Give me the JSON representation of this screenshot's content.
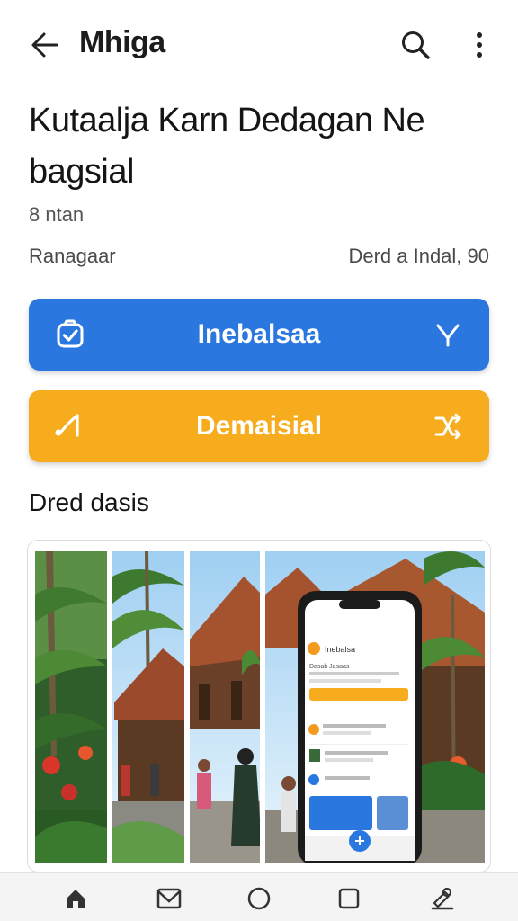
{
  "appbar": {
    "title": "Mhiga",
    "back_icon": "arrow-left-icon",
    "search_icon": "search-icon",
    "more_icon": "more-vertical-icon"
  },
  "page": {
    "heading": "Kutaalja Karn Dedagan Ne bagsial",
    "subtitle": "8 ntan",
    "meta_left": "Ranagaar",
    "meta_right": "Derd a Indal, 90"
  },
  "actions": {
    "primary": {
      "label": "Inebalsaa",
      "left_icon": "shield-check-icon",
      "right_icon": "chevron-down-icon",
      "color": "#2b77e0"
    },
    "secondary": {
      "label": "Demaisial",
      "left_icon": "route-icon",
      "right_icon": "shuffle-icon",
      "color": "#f6ac1d"
    }
  },
  "section": {
    "title": "Dred dasis"
  },
  "gallery": {
    "phone_mockup": {
      "header_title": "Inebalsa",
      "header_subtitle": "Dasab Jasaas"
    }
  },
  "bottom_nav": {
    "items": [
      "home-icon",
      "mail-icon",
      "circle-icon",
      "square-icon",
      "person-edit-icon"
    ]
  }
}
